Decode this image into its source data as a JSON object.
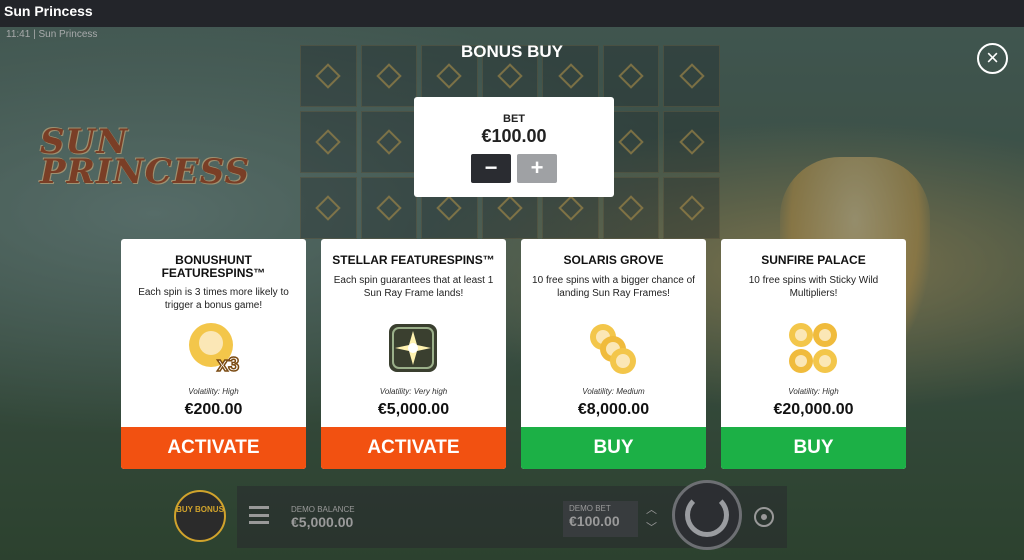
{
  "window": {
    "title": "Sun Princess"
  },
  "status": {
    "time": "11:41",
    "game_name": "Sun Princess"
  },
  "bonus_buy": {
    "title": "BONUS BUY",
    "bet_label": "BET",
    "bet_value": "€100.00",
    "minus_label": "−",
    "plus_label": "+",
    "close_label": "×"
  },
  "cards": [
    {
      "name": "BONUSHUNT FEATURESPINS™",
      "description": "Each spin is 3 times more likely to trigger a bonus game!",
      "art_icon": "princess-x3-icon",
      "art_text": "x3",
      "volatility": "Volatility: High",
      "price": "€200.00",
      "action": "ACTIVATE",
      "action_color": "#f25111"
    },
    {
      "name": "STELLAR FEATURESPINS™",
      "description": "Each spin guarantees that at least 1 Sun Ray Frame lands!",
      "art_icon": "sun-ray-frame-icon",
      "art_text": "",
      "volatility": "Volatility: Very high",
      "price": "€5,000.00",
      "action": "ACTIVATE",
      "action_color": "#f25111"
    },
    {
      "name": "SOLARIS GROVE",
      "description": "10 free spins with a bigger chance of landing Sun Ray Frames!",
      "art_icon": "princess-trio-icon",
      "art_text": "",
      "volatility": "Volatility: Medium",
      "price": "€8,000.00",
      "action": "BUY",
      "action_color": "#1cb046"
    },
    {
      "name": "SUNFIRE PALACE",
      "description": "10 free spins with Sticky Wild Multipliers!",
      "art_icon": "princess-quad-icon",
      "art_text": "",
      "volatility": "Volatility: High",
      "price": "€20,000.00",
      "action": "BUY",
      "action_color": "#1cb046"
    }
  ],
  "bottom_bar": {
    "buy_bonus_label": "BUY BONUS",
    "demo_balance_label": "DEMO BALANCE",
    "demo_balance_value": "€5,000.00",
    "demo_bet_label": "DEMO BET",
    "demo_bet_value": "€100.00"
  }
}
